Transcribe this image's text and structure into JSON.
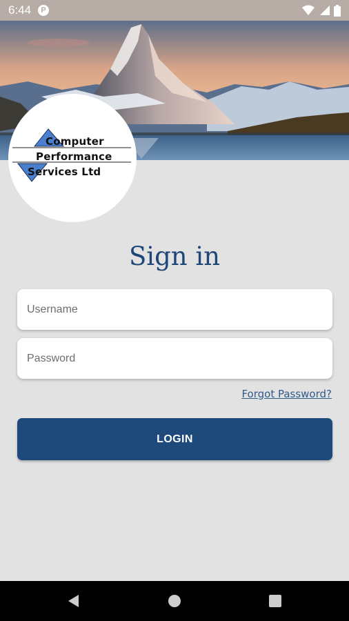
{
  "status_bar": {
    "time": "6:44",
    "app_badge": "P",
    "icons": [
      "wifi-icon",
      "signal-icon",
      "battery-icon"
    ]
  },
  "hero": {
    "image": "mountain-landscape-image"
  },
  "logo": {
    "line1": "Computer",
    "line2": "Performance",
    "line3": "Services Ltd",
    "accent_color": "#4a7fd0"
  },
  "title": "Sign in",
  "form": {
    "username_placeholder": "Username",
    "password_placeholder": "Password",
    "forgot_password": "Forgot Password?",
    "login_label": "LOGIN"
  },
  "nav_bar": {
    "icons": [
      "back-icon",
      "home-icon",
      "recents-icon"
    ]
  },
  "colors": {
    "primary": "#1d4a7a",
    "title": "#1f4679",
    "background": "#e2e2e2",
    "link": "#2f5a8b"
  }
}
